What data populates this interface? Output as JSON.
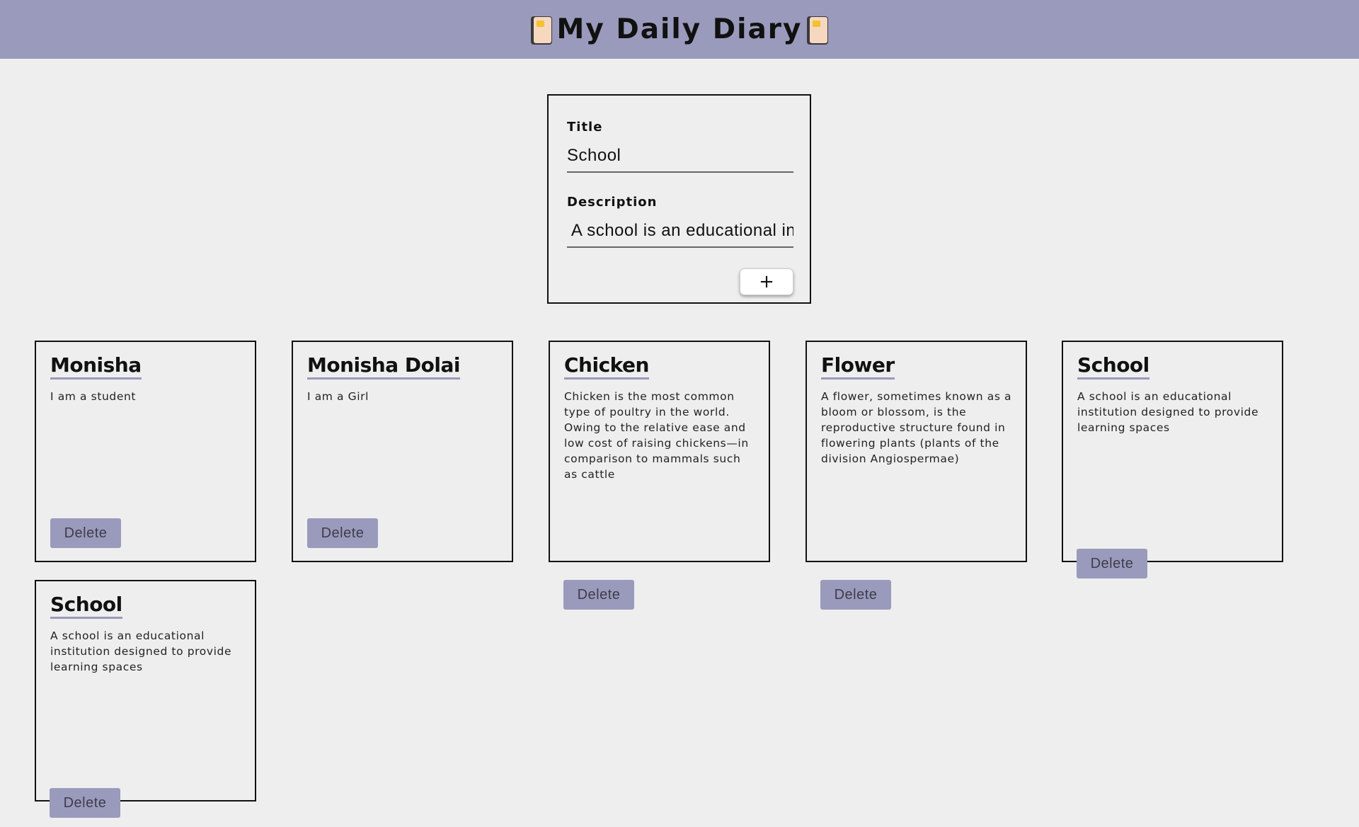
{
  "header": {
    "title": "My Daily Diary",
    "icon_left": "book-icon",
    "icon_right": "book-icon",
    "background": "#9a9abd"
  },
  "form": {
    "title_label": "Title",
    "title_value": "School",
    "description_label": "Description",
    "description_value": " A school is an educational institution designed to provide learning spaces",
    "add_label": "+"
  },
  "notes": [
    {
      "title": "Monisha",
      "description": "I am a student",
      "delete_label": "Delete"
    },
    {
      "title": "Monisha Dolai",
      "description": "I am a Girl",
      "delete_label": "Delete"
    },
    {
      "title": "Chicken",
      "description": "Chicken is the most common type of poultry in the world. Owing to the relative ease and low cost of raising chickens—in comparison to mammals such as cattle",
      "delete_label": "Delete"
    },
    {
      "title": "Flower",
      "description": "A flower, sometimes known as a bloom or blossom, is the reproductive structure found in flowering plants (plants of the division Angiospermae)",
      "delete_label": "Delete"
    },
    {
      "title": "School",
      "description": "A school is an educational institution designed to provide learning spaces",
      "delete_label": "Delete"
    },
    {
      "title": "School",
      "description": "A school is an educational institution designed to provide learning spaces",
      "delete_label": "Delete"
    }
  ],
  "colors": {
    "accent": "#9a9abd",
    "background": "#eeeeee"
  }
}
